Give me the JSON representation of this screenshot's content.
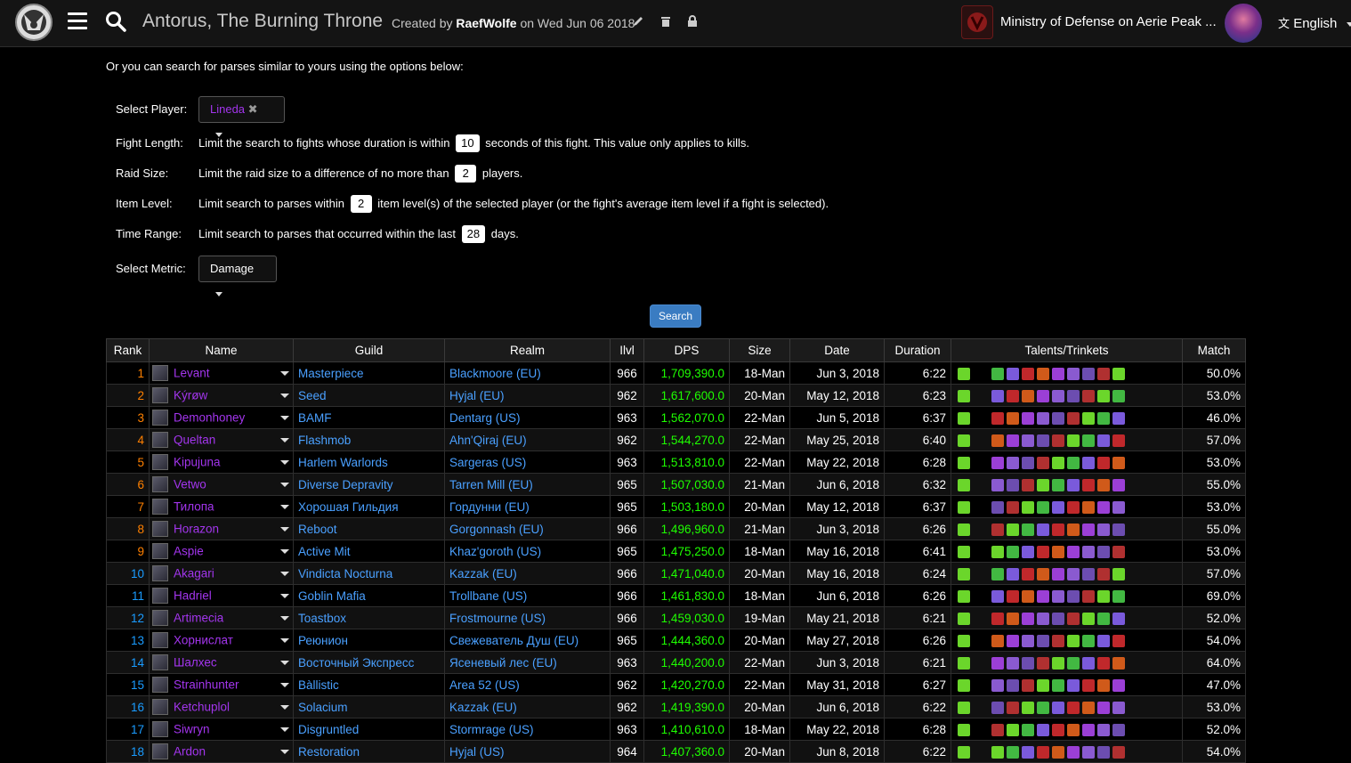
{
  "header": {
    "title": "Antorus, The Burning Throne",
    "created_prefix": "Created by",
    "author": "RaefWolfe",
    "created_suffix": "on Wed Jun 06 2018",
    "guild": "Ministry of Defense on Aerie Peak ...",
    "language": "English"
  },
  "form": {
    "intro": "Or you can search for parses similar to yours using the options below:",
    "player_label": "Select Player:",
    "player_value": "Lineda",
    "fight_label": "Fight Length:",
    "fight_text_a": "Limit the search to fights whose duration is within",
    "fight_value": "10",
    "fight_text_b": "seconds of this fight. This value only applies to kills.",
    "raid_label": "Raid Size:",
    "raid_text_a": "Limit the raid size to a difference of no more than",
    "raid_value": "2",
    "raid_text_b": "players.",
    "ilvl_label": "Item Level:",
    "ilvl_text_a": "Limit search to parses within",
    "ilvl_value": "2",
    "ilvl_text_b": "item level(s) of the selected player (or the fight's average item level if a fight is selected).",
    "time_label": "Time Range:",
    "time_text_a": "Limit search to parses that occurred within the last",
    "time_value": "28",
    "time_text_b": "days.",
    "metric_label": "Select Metric:",
    "metric_value": "Damage",
    "search_label": "Search"
  },
  "table": {
    "columns": [
      "Rank",
      "Name",
      "Guild",
      "Realm",
      "Ilvl",
      "DPS",
      "Size",
      "Date",
      "Duration",
      "Talents/Trinkets",
      "Match"
    ],
    "rows": [
      {
        "rank": "1",
        "name": "Levant",
        "guild": "Masterpiece",
        "realm": "Blackmoore (EU)",
        "ilvl": "966",
        "dps": "1,709,390.0",
        "size": "18-Man",
        "date": "Jun 3, 2018",
        "duration": "6:22",
        "match": "50.0%"
      },
      {
        "rank": "2",
        "name": "Kýrøw",
        "guild": "Seed",
        "realm": "Hyjal (EU)",
        "ilvl": "962",
        "dps": "1,617,600.0",
        "size": "20-Man",
        "date": "May 12, 2018",
        "duration": "6:23",
        "match": "53.0%"
      },
      {
        "rank": "3",
        "name": "Demonhoney",
        "guild": "BAMF",
        "realm": "Dentarg (US)",
        "ilvl": "963",
        "dps": "1,562,070.0",
        "size": "22-Man",
        "date": "Jun 5, 2018",
        "duration": "6:37",
        "match": "46.0%"
      },
      {
        "rank": "4",
        "name": "Queltan",
        "guild": "Flashmob",
        "realm": "Ahn'Qiraj (EU)",
        "ilvl": "962",
        "dps": "1,544,270.0",
        "size": "22-Man",
        "date": "May 25, 2018",
        "duration": "6:40",
        "match": "57.0%"
      },
      {
        "rank": "5",
        "name": "Kipujuna",
        "guild": "Harlem Warlords",
        "realm": "Sargeras (US)",
        "ilvl": "963",
        "dps": "1,513,810.0",
        "size": "22-Man",
        "date": "May 22, 2018",
        "duration": "6:28",
        "match": "53.0%"
      },
      {
        "rank": "6",
        "name": "Vetwo",
        "guild": "Diverse Depravity",
        "realm": "Tarren Mill (EU)",
        "ilvl": "965",
        "dps": "1,507,030.0",
        "size": "21-Man",
        "date": "Jun 6, 2018",
        "duration": "6:32",
        "match": "55.0%"
      },
      {
        "rank": "7",
        "name": "Тилопа",
        "guild": "Хорошая Гильдия",
        "realm": "Гордунни (EU)",
        "ilvl": "965",
        "dps": "1,503,180.0",
        "size": "20-Man",
        "date": "May 12, 2018",
        "duration": "6:37",
        "match": "53.0%"
      },
      {
        "rank": "8",
        "name": "Horazon",
        "guild": "Reboot",
        "realm": "Gorgonnash (EU)",
        "ilvl": "966",
        "dps": "1,496,960.0",
        "size": "21-Man",
        "date": "Jun 3, 2018",
        "duration": "6:26",
        "match": "55.0%"
      },
      {
        "rank": "9",
        "name": "Aspie",
        "guild": "Active Mit",
        "realm": "Khaz'goroth (US)",
        "ilvl": "965",
        "dps": "1,475,250.0",
        "size": "18-Man",
        "date": "May 16, 2018",
        "duration": "6:41",
        "match": "53.0%"
      },
      {
        "rank": "10",
        "name": "Akagari",
        "guild": "Vindicta Nocturna",
        "realm": "Kazzak (EU)",
        "ilvl": "966",
        "dps": "1,471,040.0",
        "size": "20-Man",
        "date": "May 16, 2018",
        "duration": "6:24",
        "match": "57.0%"
      },
      {
        "rank": "11",
        "name": "Hadriel",
        "guild": "Goblin Mafia",
        "realm": "Trollbane (US)",
        "ilvl": "966",
        "dps": "1,461,830.0",
        "size": "18-Man",
        "date": "Jun 6, 2018",
        "duration": "6:26",
        "match": "69.0%"
      },
      {
        "rank": "12",
        "name": "Artimecia",
        "guild": "Toastbox",
        "realm": "Frostmourne (US)",
        "ilvl": "966",
        "dps": "1,459,030.0",
        "size": "19-Man",
        "date": "May 21, 2018",
        "duration": "6:21",
        "match": "52.0%"
      },
      {
        "rank": "13",
        "name": "Хорнислат",
        "guild": "Реюнион",
        "realm": "Свежеватель Душ (EU)",
        "ilvl": "965",
        "dps": "1,444,360.0",
        "size": "20-Man",
        "date": "May 27, 2018",
        "duration": "6:26",
        "match": "54.0%"
      },
      {
        "rank": "14",
        "name": "Шалхес",
        "guild": "Восточный Экспресс",
        "realm": "Ясеневый лес (EU)",
        "ilvl": "963",
        "dps": "1,440,200.0",
        "size": "22-Man",
        "date": "Jun 3, 2018",
        "duration": "6:21",
        "match": "64.0%"
      },
      {
        "rank": "15",
        "name": "Strainhunter",
        "guild": "Bàllistic",
        "realm": "Area 52 (US)",
        "ilvl": "962",
        "dps": "1,420,270.0",
        "size": "22-Man",
        "date": "May 31, 2018",
        "duration": "6:27",
        "match": "47.0%"
      },
      {
        "rank": "16",
        "name": "Ketchuplol",
        "guild": "Solacium",
        "realm": "Kazzak (EU)",
        "ilvl": "962",
        "dps": "1,419,390.0",
        "size": "20-Man",
        "date": "Jun 6, 2018",
        "duration": "6:22",
        "match": "53.0%"
      },
      {
        "rank": "17",
        "name": "Siwryn",
        "guild": "Disgruntled",
        "realm": "Stormrage (US)",
        "ilvl": "963",
        "dps": "1,410,610.0",
        "size": "18-Man",
        "date": "May 22, 2018",
        "duration": "6:28",
        "match": "52.0%"
      },
      {
        "rank": "18",
        "name": "Ardon",
        "guild": "Restoration",
        "realm": "Hyjal (US)",
        "ilvl": "964",
        "dps": "1,407,360.0",
        "size": "20-Man",
        "date": "Jun 8, 2018",
        "duration": "6:22",
        "match": "54.0%"
      }
    ],
    "talent_colors": [
      "#6bd62b",
      "#42b842",
      "#7a5adb",
      "#c0282b",
      "#d05a1a",
      "#9b3fd6",
      "#8a5ad0",
      "#6c4db0",
      "#b03030"
    ]
  }
}
